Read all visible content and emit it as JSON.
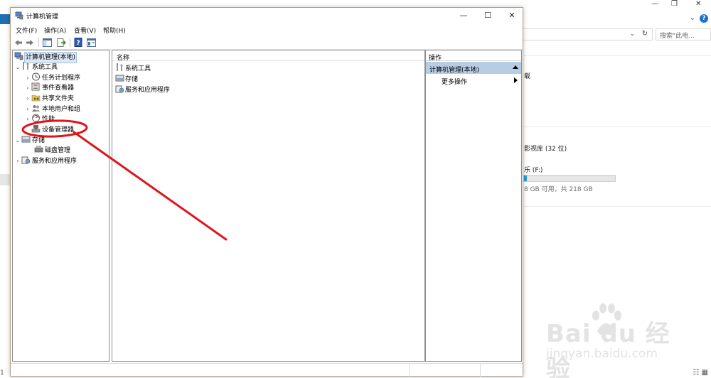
{
  "background_window": {
    "search_placeholder": "搜索\"此电...",
    "snippet_1": "载",
    "snippet_2": "影视库 (32 位)",
    "drive_label": "乐 (F:)",
    "drive_space": "8 GB 可用，共 218 GB",
    "status_left": "1",
    "drive_usage_fraction": 0.03
  },
  "window": {
    "title": "计算机管理",
    "minimize": "—",
    "maximize": "☐",
    "close": "✕"
  },
  "menu": {
    "file": "文件(F)",
    "action": "操作(A)",
    "view": "查看(V)",
    "help": "帮助(H)"
  },
  "tree": {
    "root": "计算机管理(本地)",
    "system_tools": "系统工具",
    "task_scheduler": "任务计划程序",
    "event_viewer": "事件查看器",
    "shared_folders": "共享文件夹",
    "local_users": "本地用户和组",
    "performance": "性能",
    "device_manager": "设备管理器",
    "storage": "存储",
    "disk_management": "磁盘管理",
    "services_apps": "服务和应用程序"
  },
  "center": {
    "column_name": "名称",
    "items": [
      "系统工具",
      "存储",
      "服务和应用程序"
    ]
  },
  "actions": {
    "header": "操作",
    "section": "计算机管理(本地)",
    "more": "更多操作"
  },
  "watermark": {
    "main": "Bai  du 经验",
    "sub": "jingyan.baidu.com"
  },
  "colors": {
    "accent_blue": "#1a6fd0",
    "action_section_bg": "#b7cde6",
    "annotation_red": "#e0141b"
  }
}
